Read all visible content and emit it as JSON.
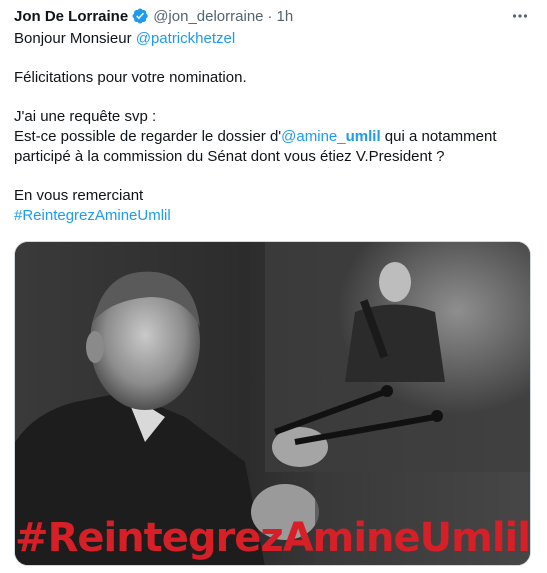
{
  "tweet": {
    "author": {
      "display_name": "Jon De Lorraine",
      "handle": "@jon_delorraine",
      "separator": "·",
      "time": "1h",
      "verified_color": "#1d9bf0"
    },
    "lines": {
      "l1_prefix": "Bonjour Monsieur ",
      "l1_mention": "@patrickhetzel",
      "l2": "Félicitations pour votre nomination.",
      "l3": "J'ai une requête svp :",
      "l4_prefix": "Est-ce possible de regarder le dossier d'",
      "l4_mention_a": "@amine_",
      "l4_mention_b": "umlil",
      "l4_suffix": " qui a notamment",
      "l5": "participé à la commission du Sénat dont vous étiez V.President ?",
      "l6": "En vous remerciant",
      "l7_hashtag": "#ReintegrezAmineUmlil"
    },
    "media": {
      "overlay_text": "#ReintegrezAmineUmlil",
      "overlay_color": "#d61f26"
    },
    "icons": {
      "verified": "verified-badge-icon",
      "more": "more-options-icon"
    }
  }
}
